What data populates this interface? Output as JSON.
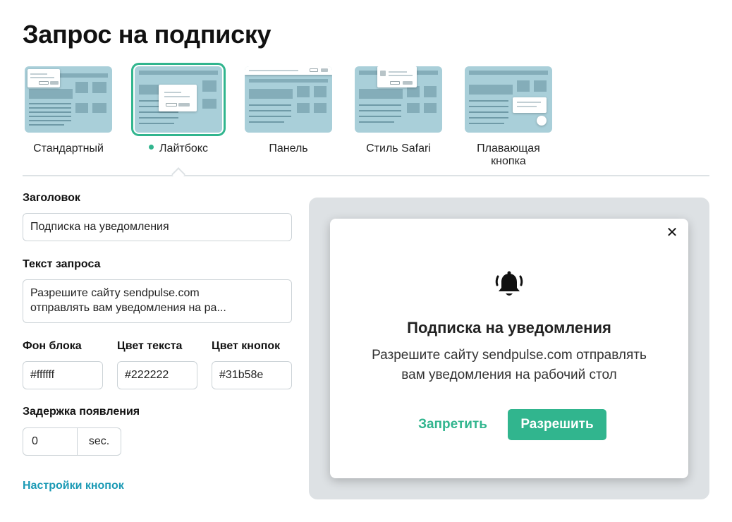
{
  "page": {
    "title": "Запрос на подписку"
  },
  "styles": [
    {
      "label": "Стандартный",
      "selected": false
    },
    {
      "label": "Лайтбокс",
      "selected": true
    },
    {
      "label": "Панель",
      "selected": false
    },
    {
      "label": "Стиль Safari",
      "selected": false
    },
    {
      "label_line1": "Плавающая",
      "label_line2": "кнопка",
      "selected": false
    }
  ],
  "form": {
    "title_label": "Заголовок",
    "title_value": "Подписка на уведомления",
    "text_label": "Текст запроса",
    "text_value_line1": "Разрешите сайту sendpulse.com",
    "text_value_line2": "отправлять вам уведомления на ра...",
    "bg_label": "Фон блока",
    "bg_value": "#ffffff",
    "text_color_label": "Цвет текста",
    "text_color_value": "#222222",
    "button_color_label": "Цвет кнопок",
    "button_color_value": "#31b58e",
    "delay_label": "Задержка появления",
    "delay_value": "0",
    "delay_unit": "sec.",
    "button_settings_link": "Настройки кнопок"
  },
  "preview": {
    "icon": "bell-icon",
    "title": "Подписка на уведомления",
    "text_line1": "Разрешите сайту sendpulse.com отправлять",
    "text_line2": "вам уведомления на рабочий стол",
    "deny_label": "Запретить",
    "allow_label": "Разрешить",
    "close_glyph": "✕"
  },
  "colors": {
    "accent": "#31b58e",
    "link": "#1b9ab5",
    "thumb_bg": "#a9cfd9",
    "preview_bg": "#dde1e4"
  }
}
